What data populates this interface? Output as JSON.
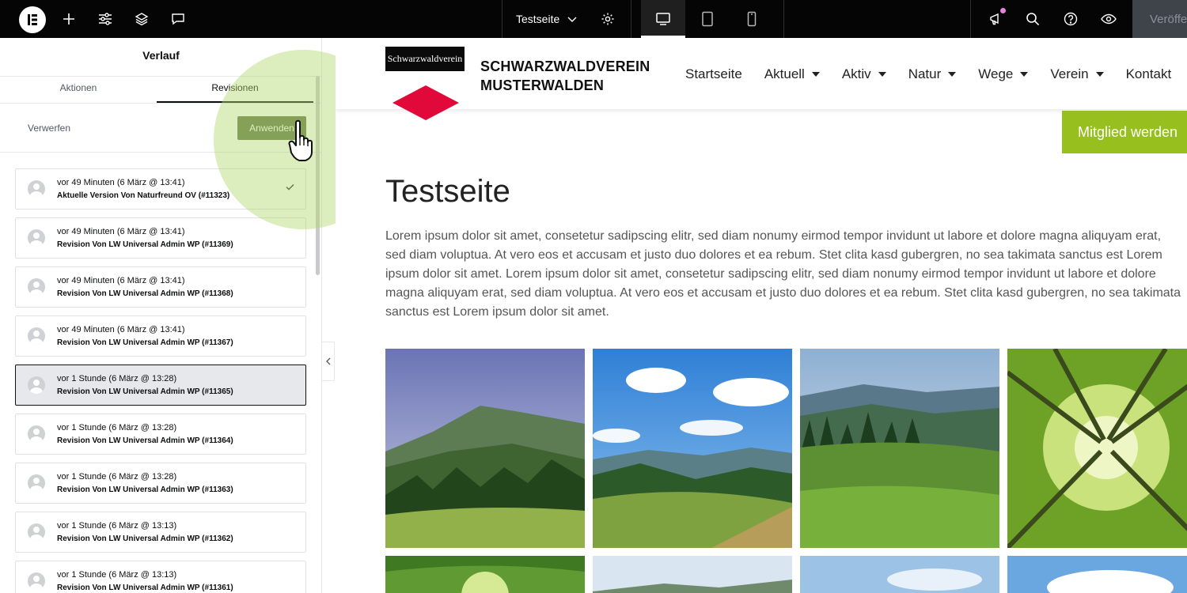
{
  "topbar": {
    "page_name": "Testseite",
    "publish_label": "Veröffentlichen"
  },
  "panel": {
    "title": "Verlauf",
    "tabs": [
      {
        "label": "Aktionen"
      },
      {
        "label": "Revisionen"
      }
    ],
    "discard_label": "Verwerfen",
    "apply_label": "Anwenden",
    "revisions": [
      {
        "date": "vor 49 Minuten (6 März @ 13:41)",
        "author": "Aktuelle Version Von Naturfreund OV (#11323)"
      },
      {
        "date": "vor 49 Minuten (6 März @ 13:41)",
        "author": "Revision Von LW Universal Admin WP (#11369)"
      },
      {
        "date": "vor 49 Minuten (6 März @ 13:41)",
        "author": "Revision Von LW Universal Admin WP (#11368)"
      },
      {
        "date": "vor 49 Minuten (6 März @ 13:41)",
        "author": "Revision Von LW Universal Admin WP (#11367)"
      },
      {
        "date": "vor 1 Stunde (6 März @ 13:28)",
        "author": "Revision Von LW Universal Admin WP (#11365)"
      },
      {
        "date": "vor 1 Stunde (6 März @ 13:28)",
        "author": "Revision Von LW Universal Admin WP (#11364)"
      },
      {
        "date": "vor 1 Stunde (6 März @ 13:28)",
        "author": "Revision Von LW Universal Admin WP (#11363)"
      },
      {
        "date": "vor 1 Stunde (6 März @ 13:13)",
        "author": "Revision Von LW Universal Admin WP (#11362)"
      },
      {
        "date": "vor 1 Stunde (6 März @ 13:13)",
        "author": "Revision Von LW Universal Admin WP (#11361)"
      }
    ]
  },
  "site": {
    "logo_text": "Schwarzwaldverein",
    "name_line1": "SCHWARZWALDVEREIN",
    "name_line2": "MUSTERWALDEN",
    "nav": [
      {
        "label": "Startseite"
      },
      {
        "label": "Aktuell"
      },
      {
        "label": "Aktiv"
      },
      {
        "label": "Natur"
      },
      {
        "label": "Wege"
      },
      {
        "label": "Verein"
      },
      {
        "label": "Kontakt"
      }
    ],
    "member_button": "Mitglied werden",
    "heading": "Testseite",
    "body_text": "Lorem ipsum dolor sit amet, consetetur sadipscing elitr, sed diam nonumy eirmod tempor invidunt ut labore et dolore magna aliquyam erat, sed diam voluptua. At vero eos et accusam et justo duo dolores et ea rebum. Stet clita kasd gubergren, no sea takimata sanctus est Lorem ipsum dolor sit amet. Lorem ipsum dolor sit amet, consetetur sadipscing elitr, sed diam nonumy eirmod tempor invidunt ut labore et dolore magna aliquyam erat, sed diam voluptua. At vero eos et accusam et justo duo dolores et ea rebum. Stet clita kasd gubergren, no sea takimata sanctus est Lorem ipsum dolor sit amet."
  },
  "colors": {
    "topbar": "#050505",
    "apply_button": "#5f7544",
    "member_button": "#97c01f",
    "logo_diamond": "#e0093a",
    "highlight": "#b2d66e"
  },
  "icons": [
    "elementor-logo-icon",
    "plus-icon",
    "sliders-icon",
    "layers-icon",
    "comment-icon",
    "chevron-down-icon",
    "gear-icon",
    "desktop-icon",
    "tablet-icon",
    "mobile-icon",
    "megaphone-icon",
    "search-icon",
    "help-icon",
    "eye-icon",
    "user-avatar-icon",
    "check-icon",
    "chevron-left-icon",
    "hand-pointer-icon"
  ]
}
